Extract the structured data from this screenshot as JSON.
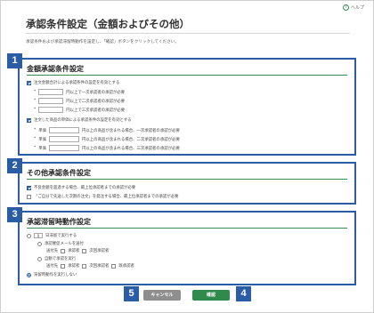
{
  "header": {
    "help_label": "ヘルプ",
    "title": "承認条件設定（金額およびその他）",
    "description": "承認条件および承認滞留時動作を設定し、「確認」ボタンをクリックしてください。"
  },
  "badges": {
    "b1": "1",
    "b2": "2",
    "b3": "3",
    "b4": "4",
    "b5": "5"
  },
  "section1": {
    "title": "金額承認条件設定",
    "amount_enable": "注文金額合計による承認条件の設定を有効とする",
    "amount_rows": [
      "円以上で一次承認者の承認が必要",
      "円以上で二次承認者の承認が必要",
      "円以上で三次承認者の承認が必要"
    ],
    "unit_enable": "注文した商品の単価による承認条件の設定を有効とする",
    "unit_prefix": "単価",
    "unit_rows": [
      "円以上の商品が含まれる場合、一次承認者の承認が必要",
      "円以上の商品が含まれる場合、二次承認者の承認が必要",
      "円以上の商品が含まれる場合、三次承認者の承認が必要"
    ]
  },
  "section2": {
    "title": "その他承認条件設定",
    "opt1": "不良金額を超過する場合、最上位承認者までの承認が必要",
    "opt2": "「ご自分で先送した次期の注文」を発注する場合、最上位承認者までの承認が必要"
  },
  "section3": {
    "title": "承認滞留時動作設定",
    "days_value": "0",
    "days_suffix": "日滞留で実行する",
    "mail_label": "承認催促メールを送付",
    "target_label": "送付先",
    "approver_label": "承認者",
    "next_approver": "次回承認者",
    "auto_label": "自動で承認を実行",
    "all_approvers": "既承認者",
    "no_action": "滞留時動作を実行しない"
  },
  "footer": {
    "cancel": "キャンセル",
    "confirm": "確認"
  }
}
